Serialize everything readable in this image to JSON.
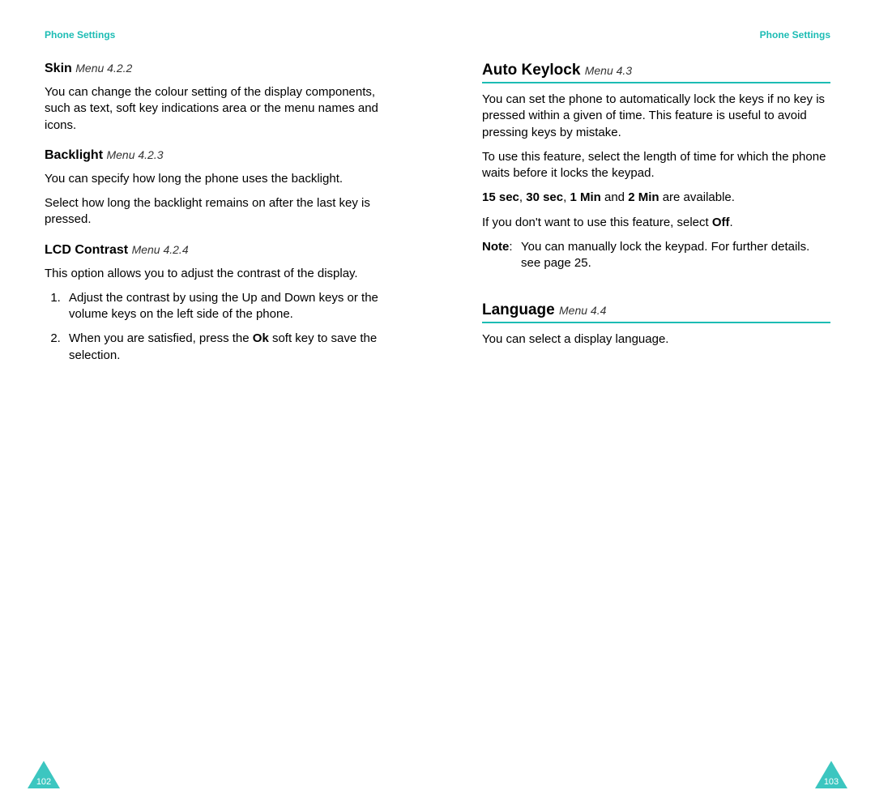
{
  "header": {
    "left": "Phone Settings",
    "right": "Phone Settings"
  },
  "accentColor": "#1CBCB4",
  "left": {
    "skin": {
      "title": "Skin",
      "menuRef": "Menu 4.2.2",
      "body": "You can change the colour setting of the display components, such as text, soft key indications area or the menu names and icons."
    },
    "backlight": {
      "title": "Backlight",
      "menuRef": "Menu 4.2.3",
      "body1": "You can specify how long the phone uses the backlight.",
      "body2": "Select how long the backlight remains on after the last key is pressed."
    },
    "lcd": {
      "title": "LCD Contrast",
      "menuRef": "Menu 4.2.4",
      "body": "This option allows you to adjust the contrast of the display.",
      "step1": "Adjust the contrast by using the Up and Down keys or the volume keys on the left side of the phone.",
      "step2_a": "When you are satisfied, press the ",
      "step2_b": "Ok",
      "step2_c": " soft key to save the selection."
    },
    "pageNumber": "102"
  },
  "right": {
    "autoKeylock": {
      "title": "Auto Keylock",
      "menuRef": "Menu 4.3",
      "body1": "You can set the phone to automatically lock the keys if no key is pressed within a given of time. This feature is useful to avoid pressing keys by mistake.",
      "body2": "To use this feature, select the length of time for which the phone waits before it locks the keypad.",
      "opts_a": "15 sec",
      "opts_b": ", ",
      "opts_c": "30 sec",
      "opts_d": ", ",
      "opts_e": "1 Min",
      "opts_f": " and ",
      "opts_g": "2 Min",
      "opts_h": " are available.",
      "off_a": "If you don't want to use this feature, select ",
      "off_b": "Off",
      "off_c": ".",
      "note_label": "Note",
      "note_sep": ": ",
      "note_body": "You can manually lock the keypad. For further details. see page 25."
    },
    "language": {
      "title": "Language",
      "menuRef": "Menu 4.4",
      "body": "You can select a display language."
    },
    "pageNumber": "103"
  }
}
